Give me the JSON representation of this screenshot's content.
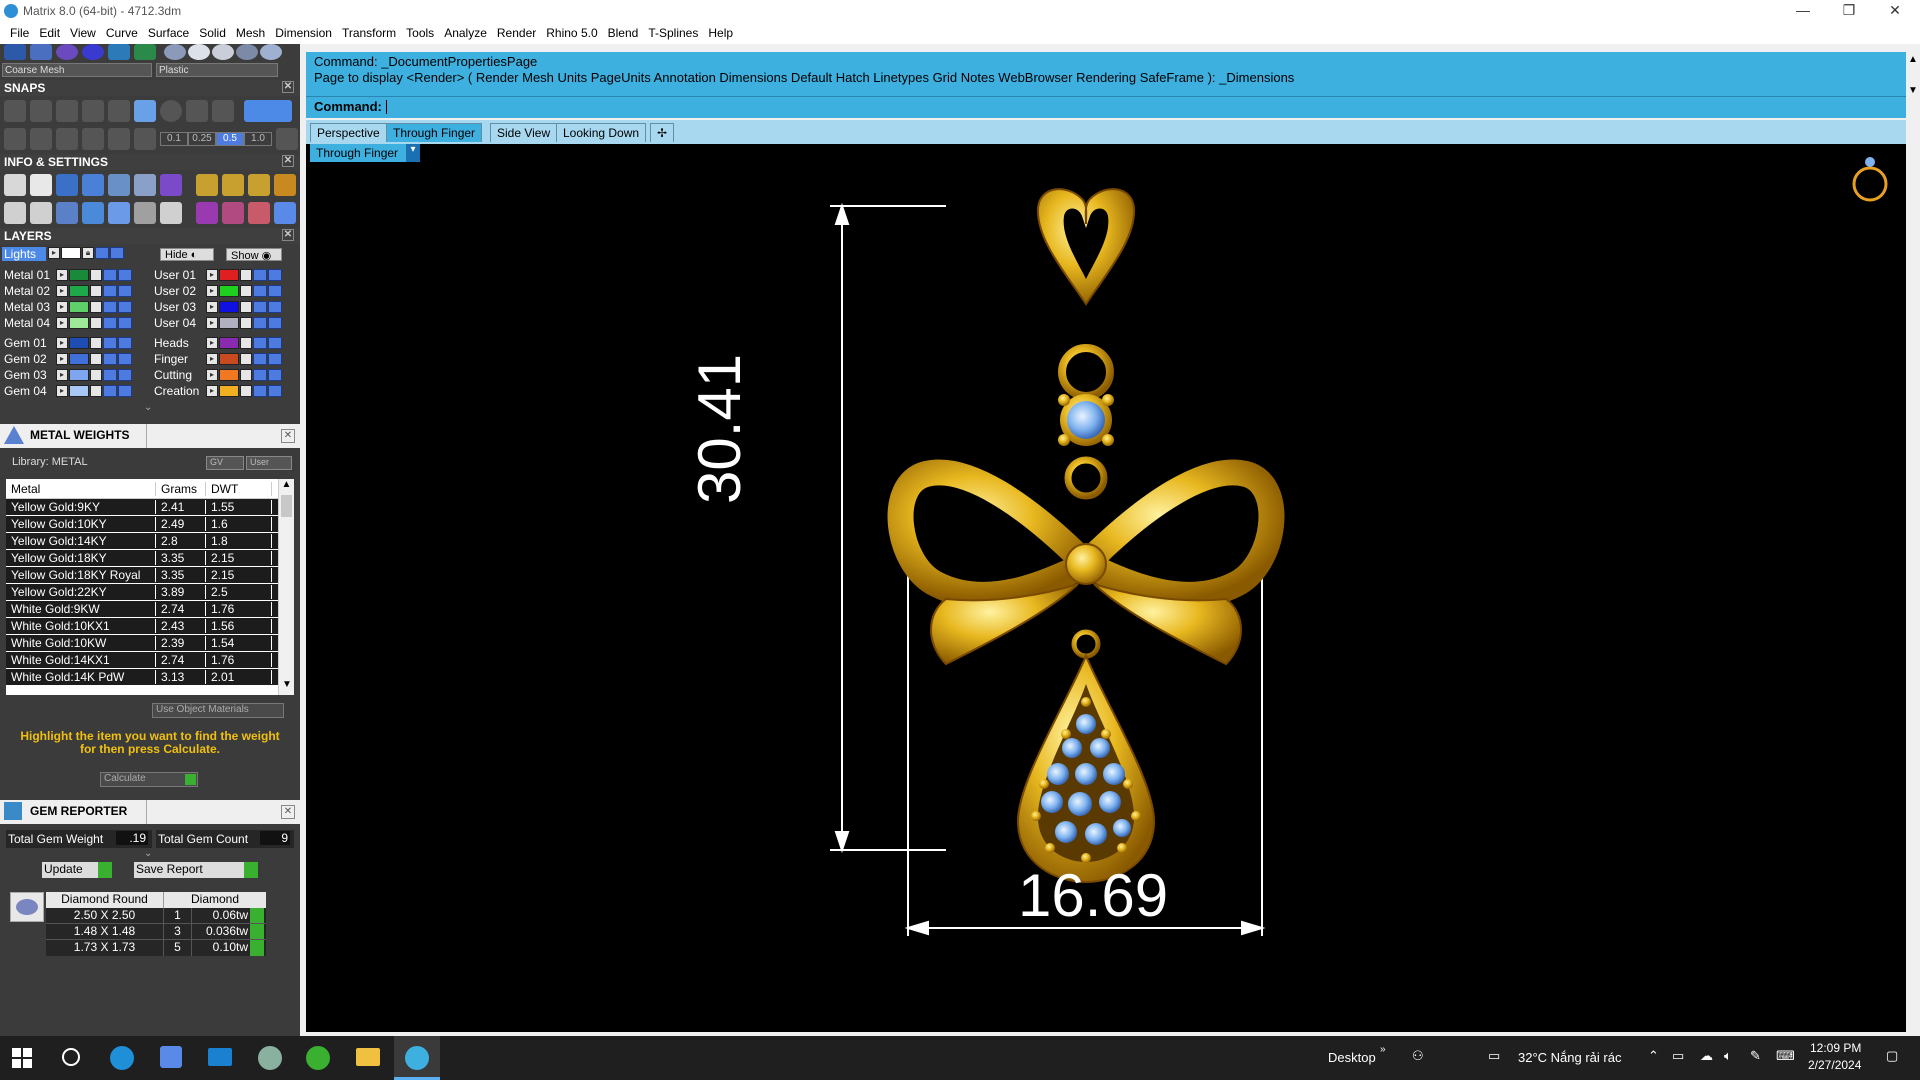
{
  "window": {
    "title": "Matrix 8.0 (64-bit) - 4712.3dm",
    "minimize": "—",
    "maximize": "❐",
    "close": "✕"
  },
  "menu": [
    "File",
    "Edit",
    "View",
    "Curve",
    "Surface",
    "Solid",
    "Mesh",
    "Dimension",
    "Transform",
    "Tools",
    "Analyze",
    "Render",
    "Rhino 5.0",
    "Blend",
    "T-Splines",
    "Help"
  ],
  "toolbar": {
    "mesh_select": "Coarse Mesh",
    "material_select": "Plastic"
  },
  "snaps": {
    "header": "SNAPS",
    "values": [
      "0.1",
      "0.25",
      "0.5",
      "1.0"
    ]
  },
  "info_settings": {
    "header": "INFO & SETTINGS"
  },
  "layers": {
    "header": "LAYERS",
    "lights_label": "Lights",
    "hide_label": "Hide",
    "show_label": "Show",
    "left": [
      {
        "name": "Metal 01",
        "color": "#1a8a3a"
      },
      {
        "name": "Metal 02",
        "color": "#1fa84a"
      },
      {
        "name": "Metal 03",
        "color": "#5fcf6a"
      },
      {
        "name": "Metal 04",
        "color": "#9ee89a"
      },
      {
        "name": "Gem 01",
        "color": "#1d4db3"
      },
      {
        "name": "Gem 02",
        "color": "#3e70d8"
      },
      {
        "name": "Gem 03",
        "color": "#7ea6ef"
      },
      {
        "name": "Gem 04",
        "color": "#a8c8f5"
      }
    ],
    "right": [
      {
        "name": "User 01",
        "color": "#e02020"
      },
      {
        "name": "User 02",
        "color": "#20d020"
      },
      {
        "name": "User 03",
        "color": "#1010e0"
      },
      {
        "name": "User 04",
        "color": "#b0b0c0"
      },
      {
        "name": "Heads",
        "color": "#8a2ab0"
      },
      {
        "name": "Finger",
        "color": "#c84a20"
      },
      {
        "name": "Cutting",
        "color": "#f07820"
      },
      {
        "name": "Creation",
        "color": "#f0b020"
      }
    ]
  },
  "metal_weights": {
    "header": "METAL WEIGHTS",
    "library": "Library: METAL",
    "gv_label": "GV",
    "user_label": "User",
    "columns": [
      "Metal",
      "Grams",
      "DWT"
    ],
    "rows": [
      [
        "Yellow Gold:9KY",
        "2.41",
        "1.55"
      ],
      [
        "Yellow Gold:10KY",
        "2.49",
        "1.6"
      ],
      [
        "Yellow Gold:14KY",
        "2.8",
        "1.8"
      ],
      [
        "Yellow Gold:18KY",
        "3.35",
        "2.15"
      ],
      [
        "Yellow Gold:18KY Royal",
        "3.35",
        "2.15"
      ],
      [
        "Yellow Gold:22KY",
        "3.89",
        "2.5"
      ],
      [
        "White Gold:9KW",
        "2.74",
        "1.76"
      ],
      [
        "White Gold:10KX1",
        "2.43",
        "1.56"
      ],
      [
        "White Gold:10KW",
        "2.39",
        "1.54"
      ],
      [
        "White Gold:14KX1",
        "2.74",
        "1.76"
      ],
      [
        "White Gold:14K PdW",
        "3.13",
        "2.01"
      ]
    ],
    "use_object_materials": "Use Object Materials",
    "hint": "Highlight the item you want to find the weight for then press Calculate.",
    "calculate": "Calculate"
  },
  "gem_reporter": {
    "header": "GEM REPORTER",
    "total_weight_label": "Total Gem Weight",
    "total_weight": ".19",
    "total_count_label": "Total Gem Count",
    "total_count": "9",
    "update": "Update",
    "save_report": "Save Report",
    "columns": [
      "Diamond Round",
      "Diamond"
    ],
    "rows": [
      [
        "2.50 X 2.50",
        "1",
        "0.06tw"
      ],
      [
        "1.48 X 1.48",
        "3",
        "0.036tw"
      ],
      [
        "1.73 X 1.73",
        "5",
        "0.10tw"
      ]
    ]
  },
  "command": {
    "line1": "Command: _DocumentPropertiesPage",
    "line2": "Page to display <Render> ( Render  Mesh  Units  PageUnits  Annotation  Dimensions  Default  Hatch  Linetypes  Grid  Notes  WebBrowser  Rendering  SafeFrame ): _Dimensions",
    "prompt": "Command:"
  },
  "viewport_tabs": [
    "Perspective",
    "Through Finger",
    "Side View",
    "Looking Down",
    "✢"
  ],
  "viewport_label": "Through Finger",
  "dimensions": {
    "height": "30.41",
    "width": "16.69"
  },
  "taskbar": {
    "desktop": "Desktop",
    "weather": "32°C  Nắng rải rác",
    "time": "12:09 PM",
    "date": "2/27/2024"
  },
  "colors": {
    "gold": "#e8b820",
    "gem_blue": "#7fb3ef",
    "cmd_blue": "#3db0e0"
  }
}
